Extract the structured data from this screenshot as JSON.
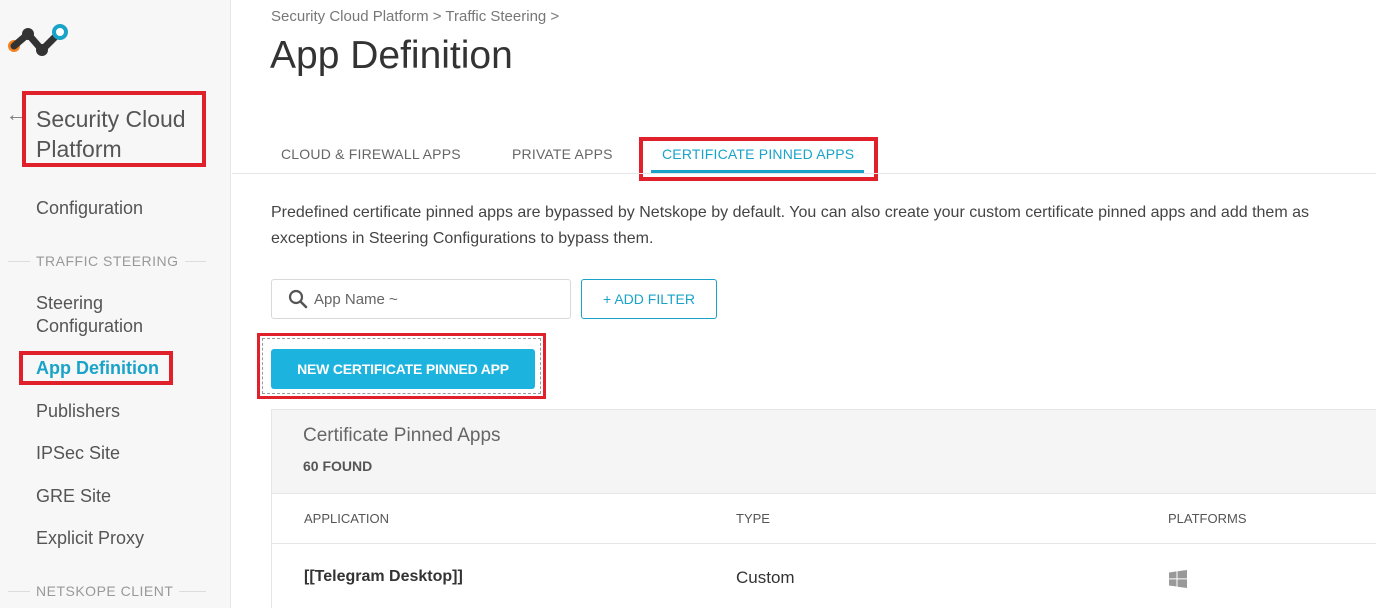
{
  "sidebar": {
    "logo_icon": "netskope-logo-icon",
    "back_icon": "back-arrow-icon",
    "platform_title": "Security Cloud Platform",
    "items": {
      "configuration": "Configuration",
      "section_traffic": "TRAFFIC STEERING",
      "steering_config": "Steering Configuration",
      "app_definition": "App Definition",
      "publishers": "Publishers",
      "ipsec_site": "IPSec Site",
      "gre_site": "GRE Site",
      "explicit_proxy": "Explicit Proxy",
      "section_client": "NETSKOPE CLIENT"
    }
  },
  "header": {
    "breadcrumb": "Security Cloud Platform > Traffic Steering >",
    "title": "App Definition"
  },
  "tabs": {
    "cloud_firewall": "CLOUD & FIREWALL APPS",
    "private": "PRIVATE APPS",
    "cert_pinned": "CERTIFICATE PINNED APPS"
  },
  "description": "Predefined certificate pinned apps are bypassed by Netskope by default. You can also create your custom certificate pinned apps and add them as exceptions in Steering Configurations to bypass them.",
  "search": {
    "placeholder": "App Name ~"
  },
  "buttons": {
    "add_filter": "+ ADD FILTER",
    "new_app": "NEW CERTIFICATE PINNED APP"
  },
  "table": {
    "title": "Certificate Pinned Apps",
    "count": "60 FOUND",
    "columns": {
      "application": "APPLICATION",
      "type": "TYPE",
      "platforms": "PLATFORMS"
    },
    "rows": [
      {
        "application": "[[Telegram Desktop]]",
        "type": "Custom",
        "platform_icon": "windows-icon"
      }
    ]
  },
  "colors": {
    "accent": "#1aa3c9",
    "highlight": "#e0202a",
    "button": "#1cb3de"
  }
}
